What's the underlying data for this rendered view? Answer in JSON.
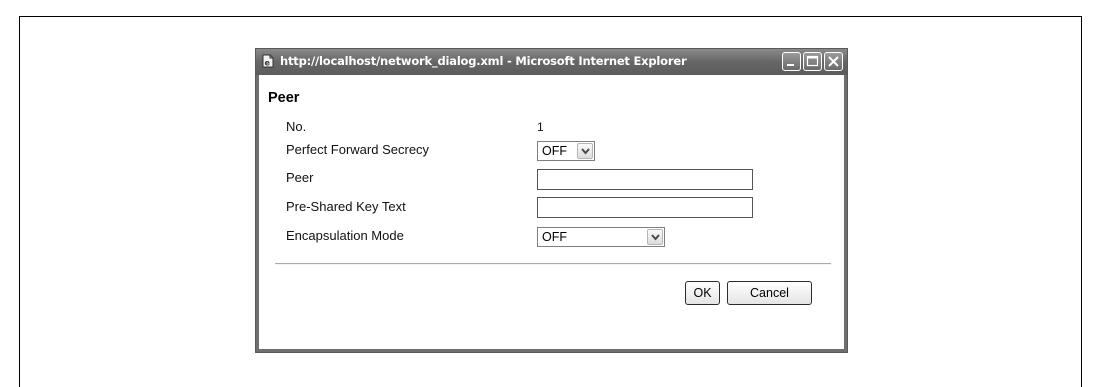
{
  "window": {
    "title": "http://localhost/network_dialog.xml - Microsoft Internet Explorer",
    "controls": [
      "minimize-icon",
      "maximize-icon",
      "close-icon"
    ]
  },
  "dialog": {
    "heading": "Peer",
    "fields": {
      "no": {
        "label": "No.",
        "value": "1"
      },
      "pfs": {
        "label": "Perfect Forward Secrecy",
        "value": "OFF"
      },
      "peer": {
        "label": "Peer",
        "value": ""
      },
      "psk": {
        "label": "Pre-Shared Key Text",
        "value": ""
      },
      "encap": {
        "label": "Encapsulation Mode",
        "value": "OFF"
      }
    },
    "buttons": {
      "ok": "OK",
      "cancel": "Cancel"
    }
  }
}
